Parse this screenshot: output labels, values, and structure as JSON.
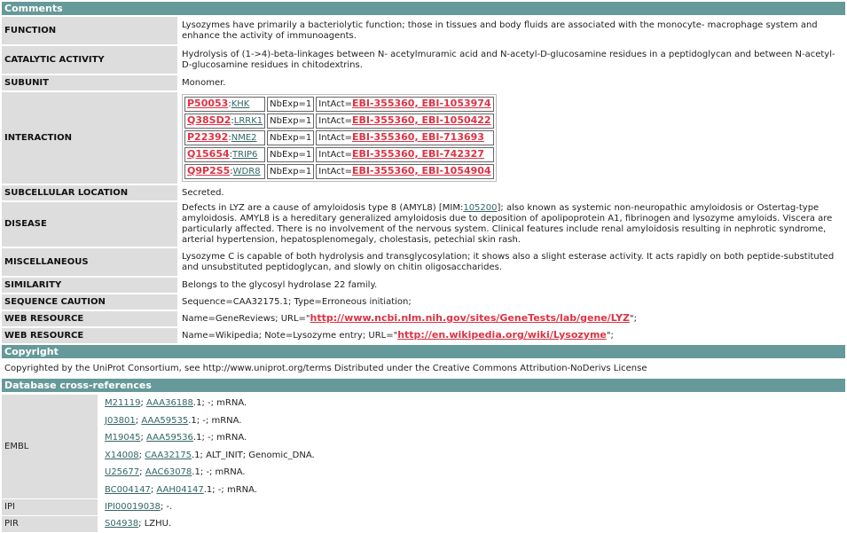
{
  "comments": {
    "header": "Comments",
    "rows": [
      {
        "label": "FUNCTION",
        "text": "Lysozymes have primarily a bacteriolytic function; those in tissues and body fluids are associated with the monocyte- macrophage system and enhance the activity of immunoagents."
      },
      {
        "label": "CATALYTIC ACTIVITY",
        "text": "Hydrolysis of (1->4)-beta-linkages between N- acetylmuramic acid and N-acetyl-D-glucosamine residues in a peptidoglycan and between N-acetyl-D-glucosamine residues in chitodextrins."
      },
      {
        "label": "SUBUNIT",
        "text": "Monomer."
      }
    ],
    "interaction": {
      "label": "INTERACTION",
      "items": [
        {
          "acc": "P50053",
          "gene": "KHK",
          "nbexp": "NbExp=1",
          "intact_prefix": "IntAct=",
          "intact": "EBI-355360, EBI-1053974"
        },
        {
          "acc": "Q38SD2",
          "gene": "LRRK1",
          "nbexp": "NbExp=1",
          "intact_prefix": "IntAct=",
          "intact": "EBI-355360, EBI-1050422"
        },
        {
          "acc": "P22392",
          "gene": "NME2",
          "nbexp": "NbExp=1",
          "intact_prefix": "IntAct=",
          "intact": "EBI-355360, EBI-713693"
        },
        {
          "acc": "Q15654",
          "gene": "TRIP6",
          "nbexp": "NbExp=1",
          "intact_prefix": "IntAct=",
          "intact": "EBI-355360, EBI-742327"
        },
        {
          "acc": "Q9P2S5",
          "gene": "WDR8",
          "nbexp": "NbExp=1",
          "intact_prefix": "IntAct=",
          "intact": "EBI-355360, EBI-1054904"
        }
      ]
    },
    "subcellular": {
      "label": "SUBCELLULAR LOCATION",
      "text": "Secreted."
    },
    "disease": {
      "label": "DISEASE",
      "before": "Defects in LYZ are a cause of amyloidosis type 8 (AMYL8) [MIM:",
      "mim": "105200",
      "after": "]; also known as systemic non-neuropathic amyloidosis or Ostertag-type amyloidosis. AMYL8 is a hereditary generalized amyloidosis due to deposition of apolipoprotein A1, fibrinogen and lysozyme amyloids. Viscera are particularly affected. There is no involvement of the nervous system. Clinical features include renal amyloidosis resulting in nephrotic syndrome, arterial hypertension, hepatosplenomegaly, cholestasis, petechial skin rash."
    },
    "misc": {
      "label": "MISCELLANEOUS",
      "text": "Lysozyme C is capable of both hydrolysis and transglycosylation; it shows also a slight esterase activity. It acts rapidly on both peptide-substituted and unsubstituted peptidoglycan, and slowly on chitin oligosaccharides."
    },
    "similarity": {
      "label": "SIMILARITY",
      "text": "Belongs to the glycosyl hydrolase 22 family."
    },
    "caution": {
      "label": "SEQUENCE CAUTION",
      "text": "Sequence=CAA32175.1; Type=Erroneous initiation;"
    },
    "web1": {
      "label": "WEB RESOURCE",
      "before": "Name=GeneReviews; URL=\"",
      "url": "http://www.ncbi.nlm.nih.gov/sites/GeneTests/lab/gene/LYZ",
      "after": "\";"
    },
    "web2": {
      "label": "WEB RESOURCE",
      "before": "Name=Wikipedia; Note=Lysozyme entry; URL=\"",
      "url": "http://en.wikipedia.org/wiki/Lysozyme",
      "after": "\";"
    }
  },
  "copyright": {
    "header": "Copyright",
    "text": "Copyrighted by the UniProt Consortium, see http://www.uniprot.org/terms Distributed under the Creative Commons Attribution-NoDerivs License"
  },
  "xrefs": {
    "header": "Database cross-references",
    "embl": {
      "label": "EMBL",
      "rows": [
        {
          "id": "M21119",
          "prot": "AAA36188",
          "rest": ".1; -; mRNA."
        },
        {
          "id": "J03801",
          "prot": "AAA59535",
          "rest": ".1; -; mRNA."
        },
        {
          "id": "M19045",
          "prot": "AAA59536",
          "rest": ".1; -; mRNA."
        },
        {
          "id": "X14008",
          "prot": "CAA32175",
          "rest": ".1; ALT_INIT; Genomic_DNA."
        },
        {
          "id": "U25677",
          "prot": "AAC63078",
          "rest": ".1; -; mRNA."
        },
        {
          "id": "BC004147",
          "prot": "AAH04147",
          "rest": ".1; -; mRNA."
        }
      ]
    },
    "ipi": {
      "label": "IPI",
      "id": "IPI00019038",
      "rest": "; -."
    },
    "pir": {
      "label": "PIR",
      "id": "S04938",
      "rest": "; LZHU."
    }
  },
  "colors": {
    "header_bg": "#669999",
    "label_bg": "#dddddd",
    "link": "#336666",
    "red_link": "#dd3344"
  }
}
